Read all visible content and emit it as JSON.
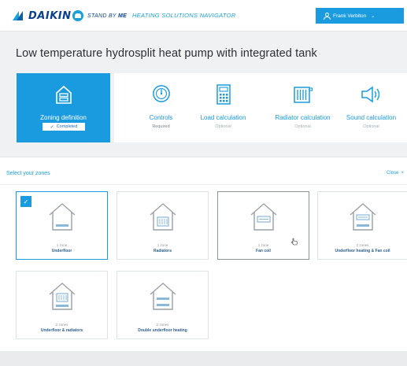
{
  "header": {
    "brand": "DAIKIN",
    "stand_by": "STAND BY",
    "stand_by_me": "ME",
    "navigator_title": "HEATING SOLUTIONS NAVIGATOR",
    "user_name": "Frank Verbiton",
    "user_icon": "person-icon",
    "chevron_icon": "chevron-down-icon"
  },
  "page": {
    "title": "Low temperature hydrosplit heat pump with integrated tank"
  },
  "steps": [
    {
      "name": "Zoning definition",
      "status": "Completed",
      "icon": "house-zones-icon",
      "state": "completed"
    },
    {
      "name": "Controls",
      "status": "Required",
      "icon": "thermostat-icon",
      "state": "required"
    },
    {
      "name": "Load calculation",
      "status": "Optional",
      "icon": "calculator-icon",
      "state": "optional"
    },
    {
      "name": "Radiator calculation",
      "status": "Optional",
      "icon": "radiator-icon",
      "state": "optional"
    },
    {
      "name": "Sound calculation",
      "status": "Optional",
      "icon": "speaker-icon",
      "state": "optional"
    }
  ],
  "zones": {
    "title": "Select your zones",
    "close_label": "Close",
    "close_icon": "close-icon",
    "options": [
      {
        "count": "1 zone",
        "name": "Underfloor",
        "selected": true,
        "emitter": "underfloor"
      },
      {
        "count": "1 zone",
        "name": "Radiators",
        "selected": false,
        "emitter": "radiator"
      },
      {
        "count": "1 zone",
        "name": "Fan coil",
        "selected": false,
        "emitter": "fancoil"
      },
      {
        "count": "2 zones",
        "name": "Underfloor heating & Fan coil",
        "selected": false,
        "emitter": "underfloor-fancoil"
      },
      {
        "count": "2 zones",
        "name": "Underfloor & radiators",
        "selected": false,
        "emitter": "underfloor-radiator"
      },
      {
        "count": "2 zones",
        "name": "Double underfloor heating",
        "selected": false,
        "emitter": "double-underfloor"
      }
    ]
  },
  "colors": {
    "accent": "#1a9be0",
    "brand_dark": "#0a3f8c",
    "background": "#f0f1f3"
  }
}
